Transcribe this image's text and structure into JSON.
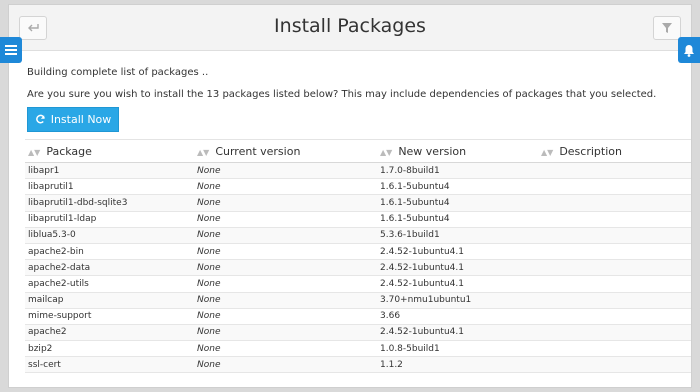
{
  "header": {
    "title": "Install Packages"
  },
  "messages": {
    "building": "Building complete list of packages ..",
    "confirm": "Are you sure you wish to install the 13 packages listed below? This may include dependencies of packages that you selected."
  },
  "install_button": {
    "label": "Install Now"
  },
  "table": {
    "columns": [
      "Package",
      "Current version",
      "New version",
      "Description"
    ],
    "rows": [
      {
        "package": "libapr1",
        "current": "None",
        "new": "1.7.0-8build1",
        "description": ""
      },
      {
        "package": "libaprutil1",
        "current": "None",
        "new": "1.6.1-5ubuntu4",
        "description": ""
      },
      {
        "package": "libaprutil1-dbd-sqlite3",
        "current": "None",
        "new": "1.6.1-5ubuntu4",
        "description": ""
      },
      {
        "package": "libaprutil1-ldap",
        "current": "None",
        "new": "1.6.1-5ubuntu4",
        "description": ""
      },
      {
        "package": "liblua5.3-0",
        "current": "None",
        "new": "5.3.6-1build1",
        "description": ""
      },
      {
        "package": "apache2-bin",
        "current": "None",
        "new": "2.4.52-1ubuntu4.1",
        "description": ""
      },
      {
        "package": "apache2-data",
        "current": "None",
        "new": "2.4.52-1ubuntu4.1",
        "description": ""
      },
      {
        "package": "apache2-utils",
        "current": "None",
        "new": "2.4.52-1ubuntu4.1",
        "description": ""
      },
      {
        "package": "mailcap",
        "current": "None",
        "new": "3.70+nmu1ubuntu1",
        "description": ""
      },
      {
        "package": "mime-support",
        "current": "None",
        "new": "3.66",
        "description": ""
      },
      {
        "package": "apache2",
        "current": "None",
        "new": "2.4.52-1ubuntu4.1",
        "description": ""
      },
      {
        "package": "bzip2",
        "current": "None",
        "new": "1.0.8-5build1",
        "description": ""
      },
      {
        "package": "ssl-cert",
        "current": "None",
        "new": "1.1.2",
        "description": ""
      }
    ]
  },
  "icons": {
    "back": "back-arrow-icon",
    "filter": "filter-icon",
    "menu": "hamburger-menu-icon",
    "notifications": "bell-icon",
    "refresh": "refresh-icon",
    "sort": "sort-icon"
  },
  "colors": {
    "accent": "#2aa7e6",
    "side_tab": "#1e88d8"
  }
}
